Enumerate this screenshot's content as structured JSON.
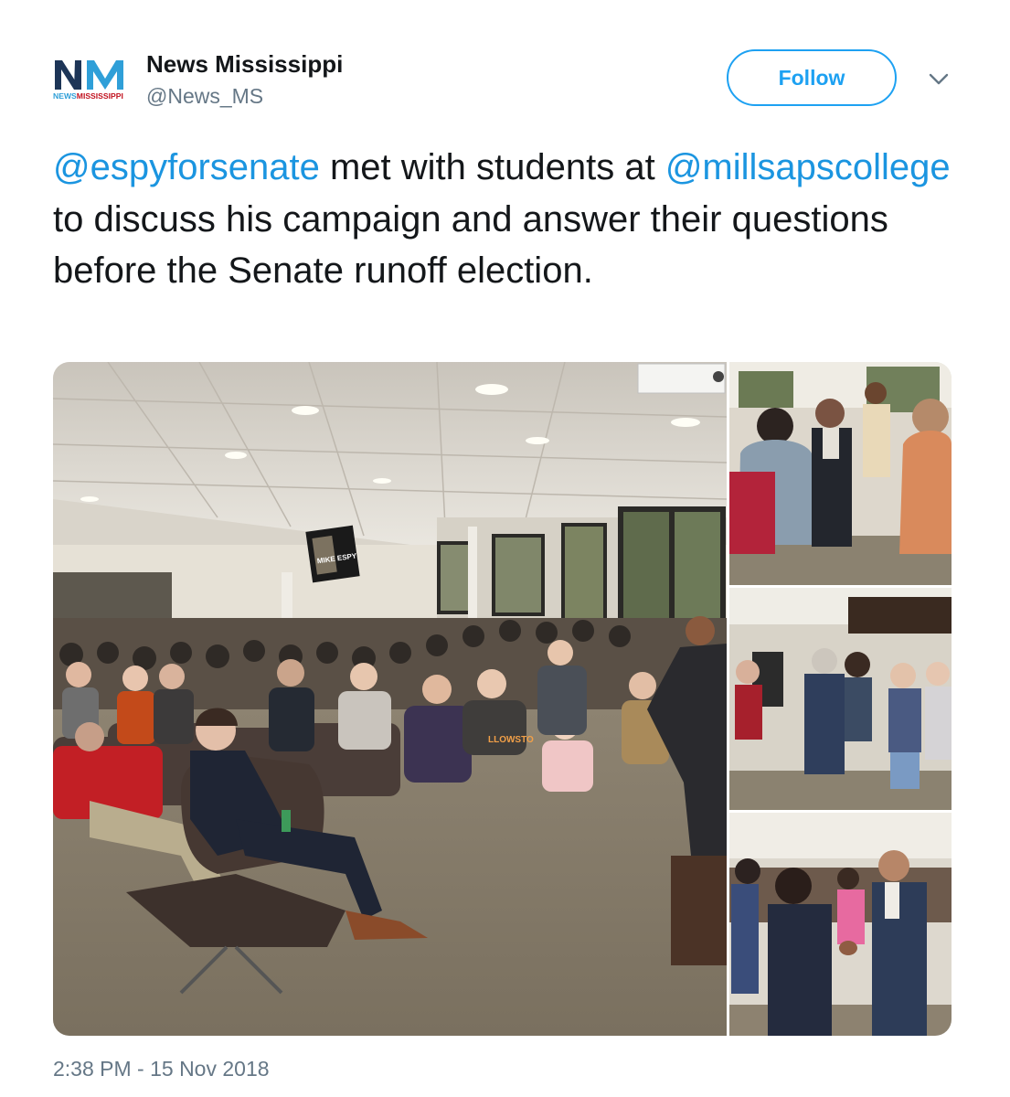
{
  "account": {
    "display_name": "News Mississippi",
    "handle": "@News_MS",
    "logo_text": "NEWSMISSISSIPPI"
  },
  "actions": {
    "follow_label": "Follow",
    "more_icon": "chevron-down-icon"
  },
  "tweet": {
    "mention_1": "@espyforsenate",
    "text_1": " met with students at ",
    "mention_2": "@millsapscollege",
    "text_2": " to discuss his campaign and answer their questions before the Senate runoff election.",
    "timestamp": "2:38 PM - 15 Nov 2018"
  },
  "media": {
    "photo_count": 4,
    "tv_text": "MIKE ESPY",
    "shirt_text": "LLOWSTO"
  },
  "colors": {
    "accent": "#1da1f2",
    "mention": "#1b95e0",
    "secondary_text": "#657786",
    "primary_text": "#14171a",
    "logo_navy": "#1d3557",
    "logo_light_blue": "#2f9fd8",
    "logo_red": "#c1121f"
  }
}
